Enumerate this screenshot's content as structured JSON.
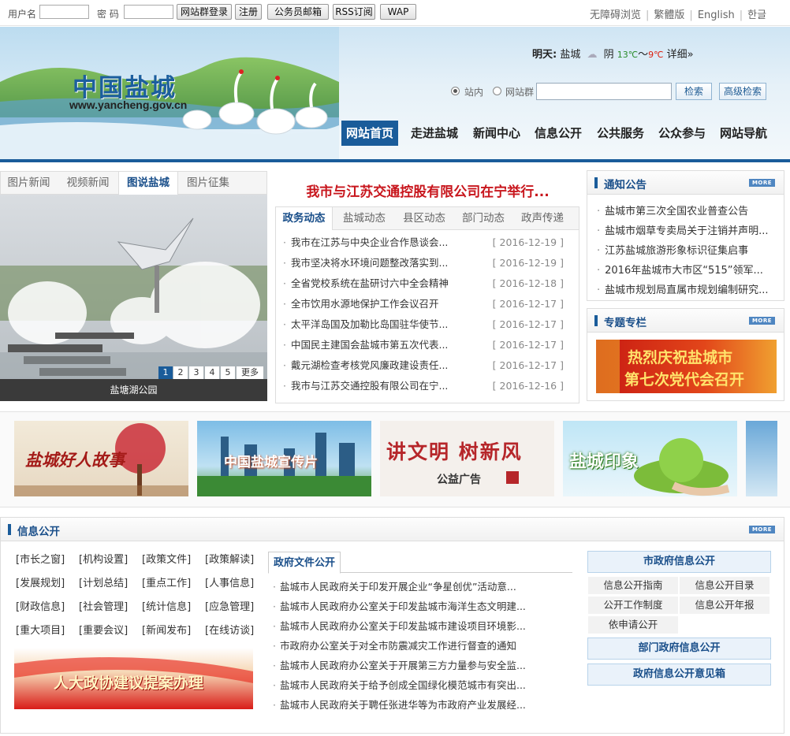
{
  "login": {
    "username_label": "用户名",
    "password_label": "密 码",
    "buttons": [
      "网站群登录",
      "注册",
      "公务员邮箱",
      "RSS订阅",
      "WAP"
    ]
  },
  "top_links": [
    "无障碍浏览",
    "繁體版",
    "English",
    "한글"
  ],
  "logo": {
    "title": "中国盐城",
    "url_text": "www.yancheng.gov.cn"
  },
  "weather": {
    "label": "明天:",
    "city": "盐城",
    "condition": "阴",
    "temp_low": "13℃",
    "sep": "～",
    "temp_high": "9℃",
    "detail": "详细»"
  },
  "search": {
    "scope_options": [
      "站内",
      "网站群"
    ],
    "selected_scope": "站内",
    "value": "",
    "search_button": "检索",
    "advanced_button": "高级检索"
  },
  "nav": [
    "网站首页",
    "走进盐城",
    "新闻中心",
    "信息公开",
    "公共服务",
    "公众参与",
    "网站导航"
  ],
  "left_tabs": [
    "图片新闻",
    "视频新闻",
    "图说盐城",
    "图片征集"
  ],
  "left_active_tab": "图说盐城",
  "photo": {
    "caption": "盐塘湖公园",
    "pages": [
      "1",
      "2",
      "3",
      "4",
      "5",
      "更多"
    ],
    "current_page": "1"
  },
  "headline": "我市与江苏交通控股有限公司在宁举行...",
  "news_tabs": [
    "政务动态",
    "盐城动态",
    "县区动态",
    "部门动态",
    "政声传递"
  ],
  "news_active_tab": "政务动态",
  "news": [
    {
      "title": "我市在江苏与中央企业合作恳谈会...",
      "date": "[ 2016-12-19 ]"
    },
    {
      "title": "我市坚决将水环境问题整改落实到...",
      "date": "[ 2016-12-19 ]"
    },
    {
      "title": "全省党校系统在盐研讨六中全会精神",
      "date": "[ 2016-12-18 ]"
    },
    {
      "title": "全市饮用水源地保护工作会议召开",
      "date": "[ 2016-12-17 ]"
    },
    {
      "title": "太平洋岛国及加勒比岛国驻华使节...",
      "date": "[ 2016-12-17 ]"
    },
    {
      "title": "中国民主建国会盐城市第五次代表...",
      "date": "[ 2016-12-17 ]"
    },
    {
      "title": "戴元湖检查考核党风廉政建设责任...",
      "date": "[ 2016-12-17 ]"
    },
    {
      "title": "我市与江苏交通控股有限公司在宁...",
      "date": "[ 2016-12-16 ]"
    }
  ],
  "notices": {
    "title": "通知公告",
    "more": "MORE",
    "items": [
      "盐城市第三次全国农业普查公告",
      "盐城市烟草专卖局关于注销并声明...",
      "江苏盐城旅游形象标识征集启事",
      "2016年盐城市大市区“515”领军...",
      "盐城市规划局直属市规划编制研究..."
    ]
  },
  "special": {
    "title": "专题专栏",
    "more": "MORE",
    "banner_line1": "热烈庆祝盐城市",
    "banner_line2": "第七次党代会召开"
  },
  "promos": [
    {
      "text": "盐城好人故事"
    },
    {
      "text": "中国盐城宣传片"
    },
    {
      "text": "讲文明 树新风",
      "sub": "公益广告"
    },
    {
      "text": "盐城印象"
    }
  ],
  "info": {
    "title": "信息公开",
    "more": "MORE",
    "links": [
      "[市长之窗]",
      "[机构设置]",
      "[政策文件]",
      "[政策解读]",
      "[发展规划]",
      "[计划总结]",
      "[重点工作]",
      "[人事信息]",
      "[财政信息]",
      "[社会管理]",
      "[统计信息]",
      "[应急管理]",
      "[重大项目]",
      "[重要会议]",
      "[新闻发布]",
      "[在线访谈]"
    ],
    "banner_text": "人大政协建议提案办理",
    "docs_tab": "政府文件公开",
    "docs": [
      "盐城市人民政府关于印发开展企业“争星创优”活动意...",
      "盐城市人民政府办公室关于印发盐城市海洋生态文明建...",
      "盐城市人民政府办公室关于印发盐城市建设项目环境影...",
      "市政府办公室关于对全市防震减灾工作进行督查的通知",
      "盐城市人民政府办公室关于开展第三方力量参与安全监...",
      "盐城市人民政府关于给予创成全国绿化模范城市有突出...",
      "盐城市人民政府关于聘任张进华等为市政府产业发展经..."
    ],
    "gov_box_title": "市政府信息公开",
    "gov_items": [
      "信息公开指南",
      "信息公开目录",
      "公开工作制度",
      "信息公开年报",
      "依申请公开"
    ],
    "dept_box": "部门政府信息公开",
    "opinion_box": "政府信息公开意见箱"
  }
}
